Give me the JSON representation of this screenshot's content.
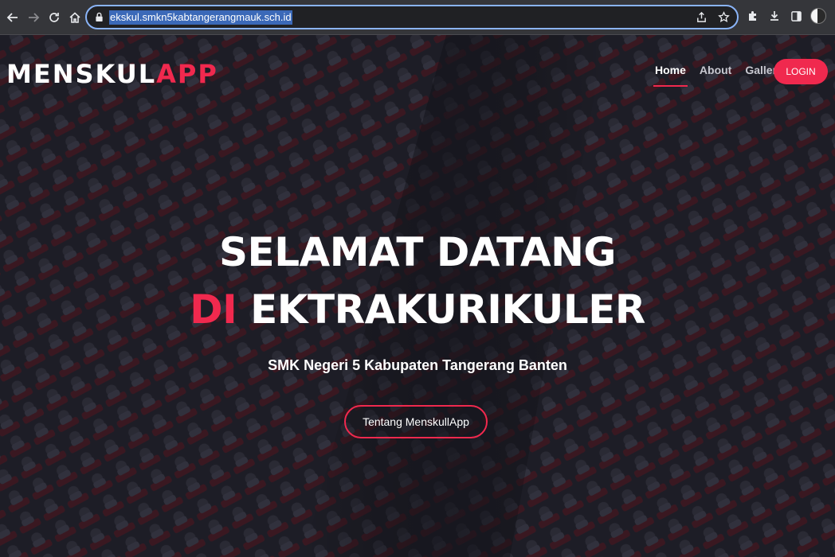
{
  "browser": {
    "url": "ekskul.smkn5kabtangerangmauk.sch.id",
    "icons": {
      "back": "back-arrow-icon",
      "forward": "forward-arrow-icon",
      "reload": "reload-icon",
      "home": "home-icon",
      "lock": "lock-icon",
      "share": "share-icon",
      "bookmark": "star-icon",
      "extensions": "puzzle-icon",
      "downloads": "download-icon",
      "sidepanel": "side-panel-icon",
      "menu": "kebab-menu-icon"
    }
  },
  "site": {
    "brand": {
      "main": "MENSKUL",
      "accent": "APP"
    },
    "nav": [
      {
        "label": "Home",
        "active": true
      },
      {
        "label": "About",
        "active": false
      },
      {
        "label": "Gallery",
        "active": false
      }
    ],
    "login_label": "LOGIN",
    "hero": {
      "line1": "SELAMAT DATANG",
      "line2_accent": "DI",
      "line2_rest": " EKTRAKURIKULER",
      "subtitle": "SMK Negeri 5 Kabupaten Tangerang Banten",
      "cta_label": "Tentang MenskullApp"
    },
    "colors": {
      "accent": "#f0294e",
      "text": "#ffffff"
    }
  }
}
